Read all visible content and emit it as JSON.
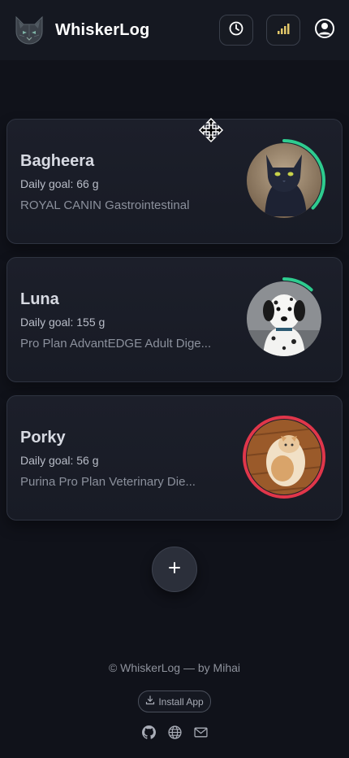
{
  "header": {
    "title": "WhiskerLog",
    "logo_icon": "cat-logo-icon",
    "actions": [
      {
        "name": "history-button",
        "icon": "clock-icon"
      },
      {
        "name": "stats-button",
        "icon": "bar-chart-icon"
      },
      {
        "name": "profile-button",
        "icon": "user-circle-icon"
      }
    ]
  },
  "pets": [
    {
      "name": "Bagheera",
      "goal": "Daily goal: 66 g",
      "food": "ROYAL CANIN Gastrointestinal",
      "progress": 0.37,
      "ring_color": "#2ecc8f",
      "photo": "black cat"
    },
    {
      "name": "Luna",
      "goal": "Daily goal: 155 g",
      "food": "Pro Plan AdvantEDGE Adult Dige...",
      "progress": 0.12,
      "ring_color": "#2ecc8f",
      "photo": "dalmatian puppy"
    },
    {
      "name": "Porky",
      "goal": "Daily goal: 56 g",
      "food": "Purina Pro Plan Veterinary Die...",
      "progress": 1.0,
      "ring_color": "#e0364a",
      "photo": "orange cat"
    }
  ],
  "add_button": {
    "icon": "plus-icon"
  },
  "footer": {
    "copyright": "© WhiskerLog — by Mihai",
    "install_label": "Install App",
    "links": [
      {
        "name": "github-link",
        "icon": "github-icon"
      },
      {
        "name": "website-link",
        "icon": "globe-icon"
      },
      {
        "name": "email-link",
        "icon": "mail-icon"
      }
    ]
  },
  "colors": {
    "background": "#10121a",
    "header": "#151821",
    "card": "#1c1f2a",
    "accent_green": "#2ecc8f",
    "accent_red": "#e0364a"
  }
}
